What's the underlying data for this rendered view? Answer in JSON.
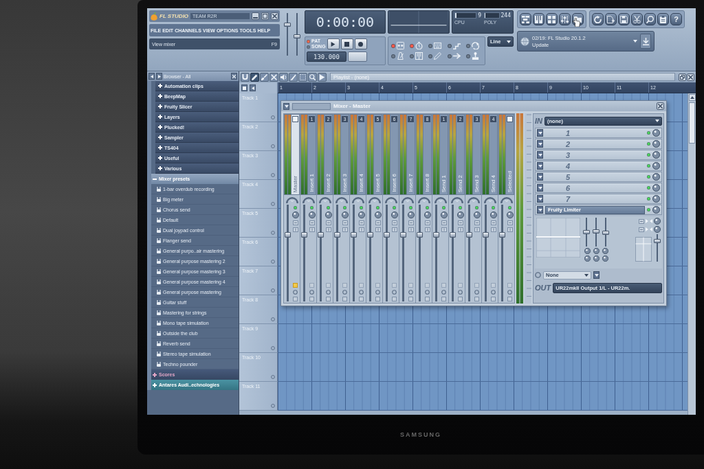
{
  "monitor": {
    "brand": "SAMSUNG"
  },
  "title_bar": {
    "logo": "FL STUDIO",
    "user": "TEAM R2R"
  },
  "menu": [
    "FILE",
    "EDIT",
    "CHANNELS",
    "VIEW",
    "OPTIONS",
    "TOOLS",
    "HELP"
  ],
  "hint_bar": {
    "text": "View mixer",
    "shortcut": "F9"
  },
  "master_sliders": [
    {
      "level": 0.75
    },
    {
      "level": 0.45
    }
  ],
  "time_display": {
    "time": "0:00:00"
  },
  "system_monitor": {
    "cpu": {
      "label": "CPU",
      "value": "9",
      "level": 0.08
    },
    "poly": {
      "label": "POLY",
      "value": "244",
      "level": 0.06
    }
  },
  "transport": {
    "modes": [
      {
        "label": "PAT",
        "selected": true
      },
      {
        "label": "SONG",
        "selected": false
      }
    ],
    "buttons": [
      {
        "kind": "play"
      },
      {
        "kind": "stop"
      },
      {
        "kind": "record"
      }
    ],
    "tempo": "130.000"
  },
  "record_options": [
    {
      "kind": "tape",
      "on": true
    },
    {
      "kind": "countdown",
      "on": true
    },
    {
      "kind": "keyboard",
      "on": false
    },
    {
      "kind": "step",
      "on": false
    },
    {
      "kind": "loop",
      "on": false
    },
    {
      "kind": "metronome",
      "on": false
    },
    {
      "kind": "piano",
      "on": false
    },
    {
      "kind": "pen",
      "on": false
    },
    {
      "kind": "arrow",
      "on": false
    },
    {
      "kind": "joystick",
      "on": false
    }
  ],
  "snap": {
    "value": "Line"
  },
  "toolbar": {
    "help": "?"
  },
  "news": {
    "headline": "02/19: FL Studio 20.1.2",
    "link": "Update"
  },
  "browser": {
    "title": "Browser - All",
    "items": [
      {
        "label": "Automation clips",
        "kind": "folder",
        "expanded": false,
        "selected": false
      },
      {
        "label": "BeepMap",
        "kind": "folder",
        "expanded": false,
        "selected": false
      },
      {
        "label": "Fruity Slicer",
        "kind": "folder",
        "expanded": false,
        "selected": false
      },
      {
        "label": "Layers",
        "kind": "folder",
        "expanded": false,
        "selected": false
      },
      {
        "label": "Plucked!",
        "kind": "folder",
        "expanded": false,
        "selected": false
      },
      {
        "label": "Sampler",
        "kind": "folder",
        "expanded": false,
        "selected": false
      },
      {
        "label": "TS404",
        "kind": "folder",
        "expanded": false,
        "selected": false
      },
      {
        "label": "Useful",
        "kind": "folder",
        "expanded": false,
        "selected": false
      },
      {
        "label": "Various",
        "kind": "folder",
        "expanded": false,
        "selected": false
      },
      {
        "label": "Mixer presets",
        "kind": "category",
        "expanded": true,
        "selected": false,
        "children": [
          {
            "label": "1-bar overdub recording"
          },
          {
            "label": "Big meter"
          },
          {
            "label": "Chorus send"
          },
          {
            "label": "Default"
          },
          {
            "label": "Dual joypad control"
          },
          {
            "label": "Flanger send"
          },
          {
            "label": "General purpo..air mastering"
          },
          {
            "label": "General purpose mastering 2"
          },
          {
            "label": "General purpose mastering 3"
          },
          {
            "label": "General purpose mastering 4"
          },
          {
            "label": "General purpose mastering"
          },
          {
            "label": "Guitar stuff"
          },
          {
            "label": "Mastering for strings"
          },
          {
            "label": "Mono tape simulation"
          },
          {
            "label": "Outside the club"
          },
          {
            "label": "Reverb send"
          },
          {
            "label": "Stereo tape simulation"
          },
          {
            "label": "Techno pounder"
          }
        ]
      },
      {
        "label": "Scores",
        "kind": "category",
        "expanded": false,
        "selected": false,
        "color": "#e2a6c6"
      },
      {
        "label": "Antares Audi..echnologies",
        "kind": "category",
        "expanded": false,
        "selected": true
      }
    ]
  },
  "playlist": {
    "title": "Playlist - (none)",
    "tools": [
      {
        "kind": "magnet",
        "selected": false
      },
      {
        "kind": "pencil",
        "selected": true
      },
      {
        "kind": "brush",
        "selected": false
      },
      {
        "kind": "delete",
        "selected": false
      },
      {
        "kind": "speaker",
        "selected": false
      },
      {
        "kind": "knife",
        "selected": false
      },
      {
        "kind": "select",
        "selected": false
      },
      {
        "kind": "zoom",
        "selected": false
      },
      {
        "kind": "play",
        "selected": false
      }
    ],
    "bars": [
      "1",
      "2",
      "3",
      "4",
      "5",
      "6",
      "7",
      "8",
      "9",
      "10",
      "11",
      "12"
    ],
    "tracks": [
      "Track 1",
      "Track 2",
      "Track 3",
      "Track 4",
      "Track 5",
      "Track 6",
      "Track 7",
      "Track 8",
      "Track 9",
      "Track 10",
      "Track 11"
    ]
  },
  "mixer": {
    "title": "Mixer - Master",
    "channels": [
      {
        "name": "Master",
        "selected": true,
        "enabled": true,
        "armed": true,
        "level": 0.7
      },
      {
        "name": "Insert 1",
        "number": "1",
        "selected": false,
        "enabled": true,
        "armed": false,
        "level": 0.7
      },
      {
        "name": "Insert 2",
        "number": "2",
        "selected": false,
        "enabled": true,
        "armed": false,
        "level": 0.7
      },
      {
        "name": "Insert 3",
        "number": "3",
        "selected": false,
        "enabled": true,
        "armed": false,
        "level": 0.7
      },
      {
        "name": "Insert 4",
        "number": "4",
        "selected": false,
        "enabled": true,
        "armed": false,
        "level": 0.7
      },
      {
        "name": "Insert 5",
        "number": "5",
        "selected": false,
        "enabled": true,
        "armed": false,
        "level": 0.7
      },
      {
        "name": "Insert 6",
        "number": "6",
        "selected": false,
        "enabled": true,
        "armed": false,
        "level": 0.7
      },
      {
        "name": "Insert 7",
        "number": "7",
        "selected": false,
        "enabled": true,
        "armed": false,
        "level": 0.7
      },
      {
        "name": "Insert 8",
        "number": "8",
        "selected": false,
        "enabled": true,
        "armed": false,
        "level": 0.7
      },
      {
        "name": "Send 1",
        "number": "1",
        "selected": false,
        "enabled": true,
        "armed": false,
        "level": 0.7
      },
      {
        "name": "Send 2",
        "number": "2",
        "selected": false,
        "enabled": true,
        "armed": false,
        "level": 0.7
      },
      {
        "name": "Send 3",
        "number": "3",
        "selected": false,
        "enabled": true,
        "armed": false,
        "level": 0.7
      },
      {
        "name": "Send 4",
        "number": "4",
        "selected": false,
        "enabled": true,
        "armed": false,
        "level": 0.7
      },
      {
        "name": "Selected",
        "selected": false,
        "enabled": true,
        "armed": false,
        "level": 0.7
      }
    ],
    "input": {
      "label": "IN",
      "value": "(none)"
    },
    "slots": [
      {
        "number": "1",
        "enabled": true
      },
      {
        "number": "2",
        "enabled": true
      },
      {
        "number": "3",
        "enabled": true
      },
      {
        "number": "4",
        "enabled": true
      },
      {
        "number": "5",
        "enabled": true
      },
      {
        "number": "6",
        "enabled": true
      },
      {
        "number": "7",
        "enabled": true
      },
      {
        "name": "Fruity Limiter",
        "enabled": true
      }
    ],
    "eq": [
      {
        "level": 0.5
      },
      {
        "level": 0.52
      },
      {
        "level": 0.48
      }
    ],
    "volume": {
      "level": 0.8
    },
    "send": {
      "value": "None"
    },
    "output": {
      "label": "OUT",
      "value": "UR22mkII Output 1/L - UR22m."
    }
  }
}
